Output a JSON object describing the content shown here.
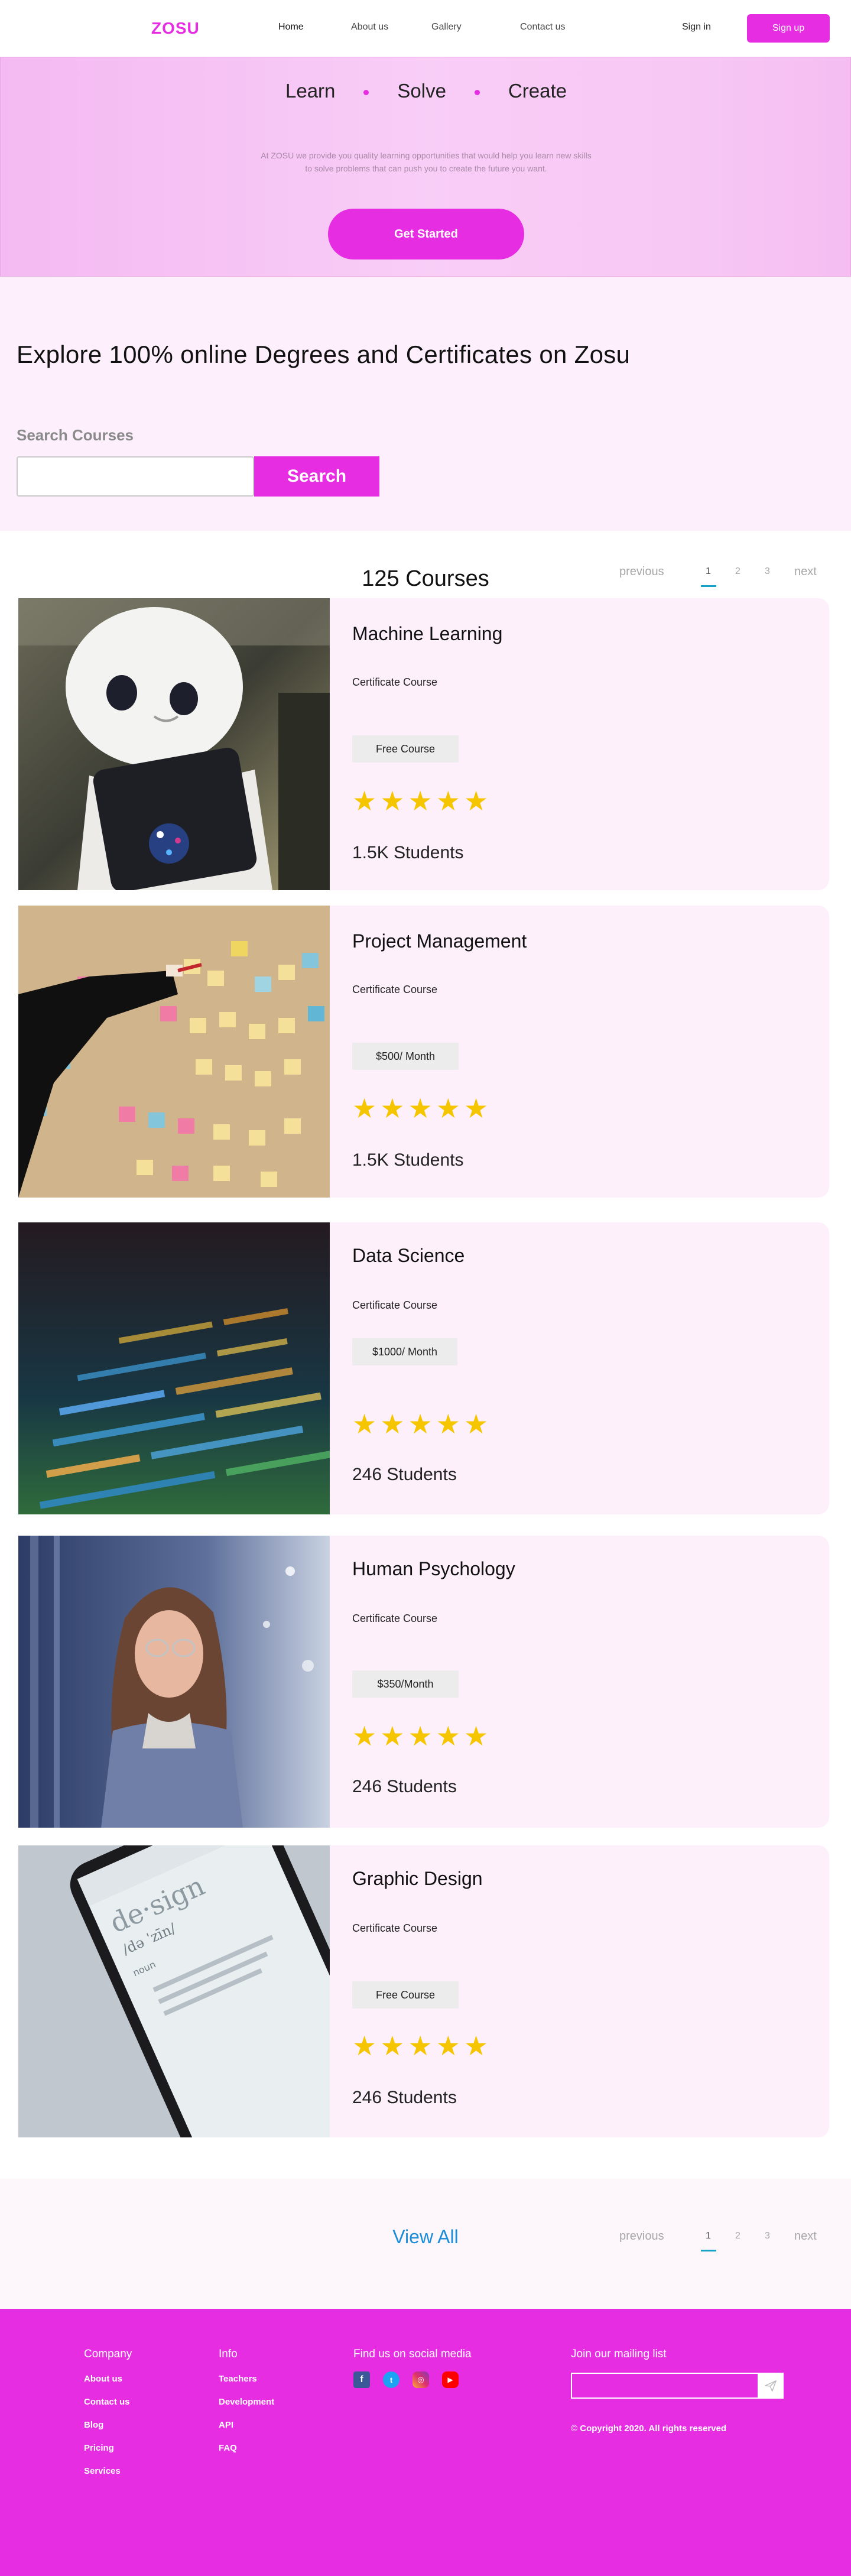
{
  "nav": {
    "logo": "ZOSU",
    "links": [
      "Home",
      "About us",
      "Gallery",
      "Contact us"
    ],
    "signin": "Sign in",
    "signup": "Sign up"
  },
  "hero": {
    "words": [
      "Learn",
      "Solve",
      "Create"
    ],
    "text_line1": "At ZOSU we provide you quality learning opportunities that would help you learn new skills",
    "text_line2": "to solve problems that can push you to create the future you want.",
    "cta": "Get Started"
  },
  "explore": {
    "title": "Explore 100% online Degrees and Certificates on Zosu",
    "search_label": "Search Courses",
    "search_value": "",
    "search_button": "Search"
  },
  "courses": {
    "count_label": "125 Courses",
    "pager": {
      "previous": "previous",
      "pages": [
        "1",
        "2",
        "3"
      ],
      "next": "next",
      "current": "1"
    },
    "items": [
      {
        "title": "Machine Learning",
        "type": "Certificate Course",
        "price": "Free Course",
        "rating": 5,
        "students_num": "1.5K",
        "students_word": "Students",
        "image": "robot-photo"
      },
      {
        "title": "Project Management",
        "type": "Certificate Course",
        "price": "$500/ Month",
        "rating": 5,
        "students_num": "1.5K",
        "students_word": "Students",
        "image": "sticky-notes-photo"
      },
      {
        "title": "Data Science",
        "type": "Certificate Course",
        "price": "$1000/ Month",
        "rating": 5,
        "students_num": "246",
        "students_word": "Students",
        "image": "code-screen-photo"
      },
      {
        "title": "Human Psychology",
        "type": "Certificate Course",
        "price": "$350/Month",
        "rating": 5,
        "students_num": "246",
        "students_word": "Students",
        "image": "woman-portrait-photo"
      },
      {
        "title": "Graphic Design",
        "type": "Certificate Course",
        "price": "Free Course",
        "rating": 5,
        "students_num": "246",
        "students_word": "Students",
        "image": "phone-design-photo"
      }
    ]
  },
  "view_all": {
    "label": "View All",
    "pager": {
      "previous": "previous",
      "pages": [
        "1",
        "2",
        "3"
      ],
      "next": "next",
      "current": "1"
    }
  },
  "footer": {
    "company": {
      "head": "Company",
      "links": [
        "About us",
        "Contact us",
        "Blog",
        "Pricing",
        "Services"
      ]
    },
    "info": {
      "head": "Info",
      "links": [
        "Teachers",
        "Development",
        "API",
        "FAQ"
      ]
    },
    "social": {
      "head": "Find us on social media",
      "icons": [
        "facebook-icon",
        "twitter-icon",
        "instagram-icon",
        "youtube-icon"
      ]
    },
    "mailing": {
      "head": "Join our mailing list",
      "placeholder": "",
      "copyright": "Copyright 2020. All rights reserved"
    }
  },
  "colors": {
    "brand": "#e62de2",
    "star": "#f5c600",
    "link": "#1a8cd8",
    "card_bg": "#fdf0fa"
  }
}
